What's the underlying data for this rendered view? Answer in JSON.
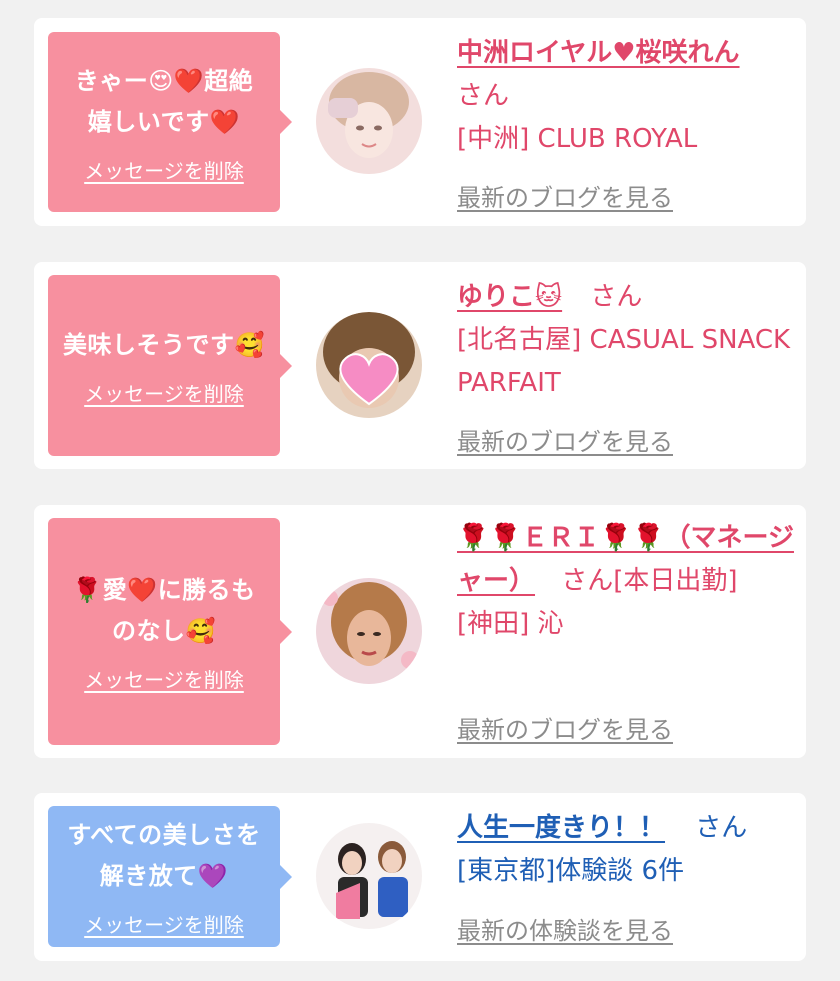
{
  "cards": [
    {
      "message": "きゃー😍❤️超絶\n嬉しいです❤️",
      "delete_label": "メッセージを削除",
      "name": "中洲ロイヤル♥桜咲れん",
      "suffix": "さん",
      "shop": "[中洲] CLUB ROYAL",
      "link_label": "最新のブログを見る",
      "bubble_color": "#f7909f"
    },
    {
      "message": "美味しそうです🥰",
      "delete_label": "メッセージを削除",
      "name": "ゆりこ🐱",
      "suffix": "さん",
      "shop": "[北名古屋] CASUAL SNACK PARFAIT",
      "link_label": "最新のブログを見る",
      "bubble_color": "#f7909f"
    },
    {
      "message": "🌹愛❤️に勝るも\nのなし🥰",
      "delete_label": "メッセージを削除",
      "name": "🌹🌹ＥＲＩ🌹🌹（マネージャー）",
      "suffix": "さん[本日出勤]",
      "shop": "[神田] 沁",
      "link_label": "最新のブログを見る",
      "bubble_color": "#f7909f"
    },
    {
      "message": "すべての美しさを\n解き放て💜",
      "delete_label": "メッセージを削除",
      "name": "人生一度きり！！",
      "suffix": "さん",
      "shop": "[東京都]体験談 6件",
      "link_label": "最新の体験談を見る",
      "bubble_color": "#8fb8f4"
    }
  ],
  "colors": {
    "pink_text": "#e0476a",
    "blue_text": "#1f5fb5",
    "link_gray": "#8c8c8c",
    "background": "#f1f1f1"
  }
}
